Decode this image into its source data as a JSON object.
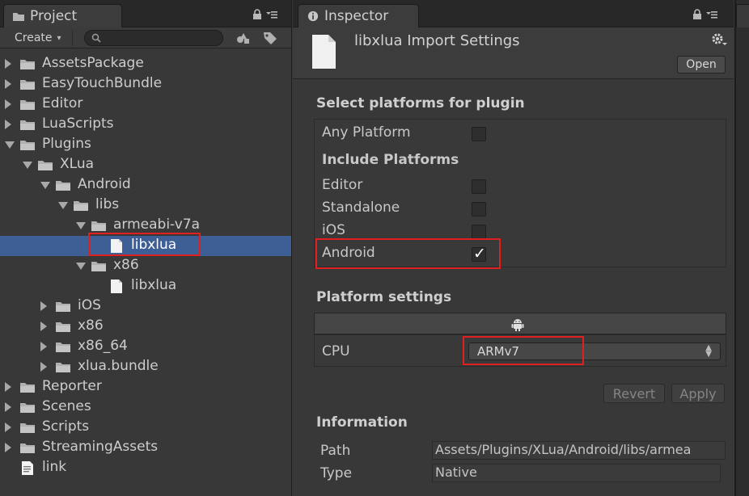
{
  "project_panel": {
    "tab_title": "Project",
    "create_label": "Create",
    "search_value": "",
    "tree": [
      {
        "label": "AssetsPackage",
        "type": "folder",
        "depth": 0,
        "expanded": false
      },
      {
        "label": "EasyTouchBundle",
        "type": "folder",
        "depth": 0,
        "expanded": false
      },
      {
        "label": "Editor",
        "type": "folder",
        "depth": 0,
        "expanded": false
      },
      {
        "label": "LuaScripts",
        "type": "folder",
        "depth": 0,
        "expanded": false
      },
      {
        "label": "Plugins",
        "type": "folder",
        "depth": 0,
        "expanded": true
      },
      {
        "label": "XLua",
        "type": "folder",
        "depth": 1,
        "expanded": true
      },
      {
        "label": "Android",
        "type": "folder",
        "depth": 2,
        "expanded": true
      },
      {
        "label": "libs",
        "type": "folder",
        "depth": 3,
        "expanded": true
      },
      {
        "label": "armeabi-v7a",
        "type": "folder",
        "depth": 4,
        "expanded": true
      },
      {
        "label": "libxlua",
        "type": "file",
        "depth": 5,
        "selected": true
      },
      {
        "label": "x86",
        "type": "folder",
        "depth": 4,
        "expanded": true
      },
      {
        "label": "libxlua",
        "type": "file",
        "depth": 5
      },
      {
        "label": "iOS",
        "type": "folder",
        "depth": 2,
        "expanded": false
      },
      {
        "label": "x86",
        "type": "folder",
        "depth": 2,
        "expanded": false
      },
      {
        "label": "x86_64",
        "type": "folder",
        "depth": 2,
        "expanded": false
      },
      {
        "label": "xlua.bundle",
        "type": "folder",
        "depth": 2,
        "expanded": false
      },
      {
        "label": "Reporter",
        "type": "folder",
        "depth": 0,
        "expanded": false
      },
      {
        "label": "Scenes",
        "type": "folder",
        "depth": 0,
        "expanded": false
      },
      {
        "label": "Scripts",
        "type": "folder",
        "depth": 0,
        "expanded": false
      },
      {
        "label": "StreamingAssets",
        "type": "folder",
        "depth": 0,
        "expanded": false
      },
      {
        "label": "link",
        "type": "doc",
        "depth": 0
      }
    ]
  },
  "inspector_panel": {
    "tab_title": "Inspector",
    "asset_title": "libxlua Import Settings",
    "open_label": "Open",
    "select_platforms_title": "Select platforms for plugin",
    "any_platform_label": "Any Platform",
    "any_platform_checked": false,
    "include_platforms_title": "Include Platforms",
    "platforms": [
      {
        "label": "Editor",
        "checked": false
      },
      {
        "label": "Standalone",
        "checked": false
      },
      {
        "label": "iOS",
        "checked": false
      },
      {
        "label": "Android",
        "checked": true
      }
    ],
    "platform_settings_title": "Platform settings",
    "cpu_label": "CPU",
    "cpu_value": "ARMv7",
    "revert_label": "Revert",
    "apply_label": "Apply",
    "information_title": "Information",
    "path_label": "Path",
    "path_value": "Assets/Plugins/XLua/Android/libs/armea",
    "type_label": "Type",
    "type_value": "Native"
  },
  "colors": {
    "selection": "#3e5f96",
    "highlight_box": "#e02020",
    "panel_bg": "#383838"
  },
  "icons": [
    "folder-icon",
    "lock-icon",
    "menu-icon",
    "search-icon",
    "gear-icon",
    "android-icon",
    "info-icon",
    "file-icon"
  ]
}
